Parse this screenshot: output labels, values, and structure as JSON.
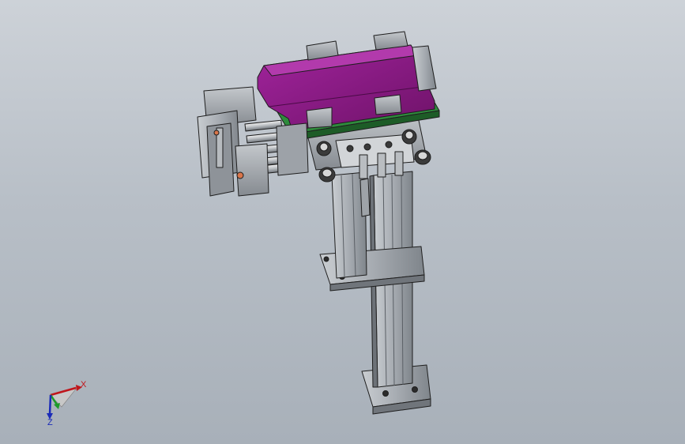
{
  "triad": {
    "x_label": "X",
    "z_label": "Z",
    "x_color": "#c0161b",
    "y_color": "#1d9b2a",
    "z_color": "#1b2bb8"
  },
  "colors": {
    "background_top": "#cdd2d8",
    "background_bottom": "#a8b0b9",
    "plate_purple": "#8b1a86",
    "pcb_green": "#2e8b3c",
    "metal_gray": "#9aa0a6",
    "dark_edge": "#2a2a2a",
    "accent_orange": "#d9754a"
  }
}
